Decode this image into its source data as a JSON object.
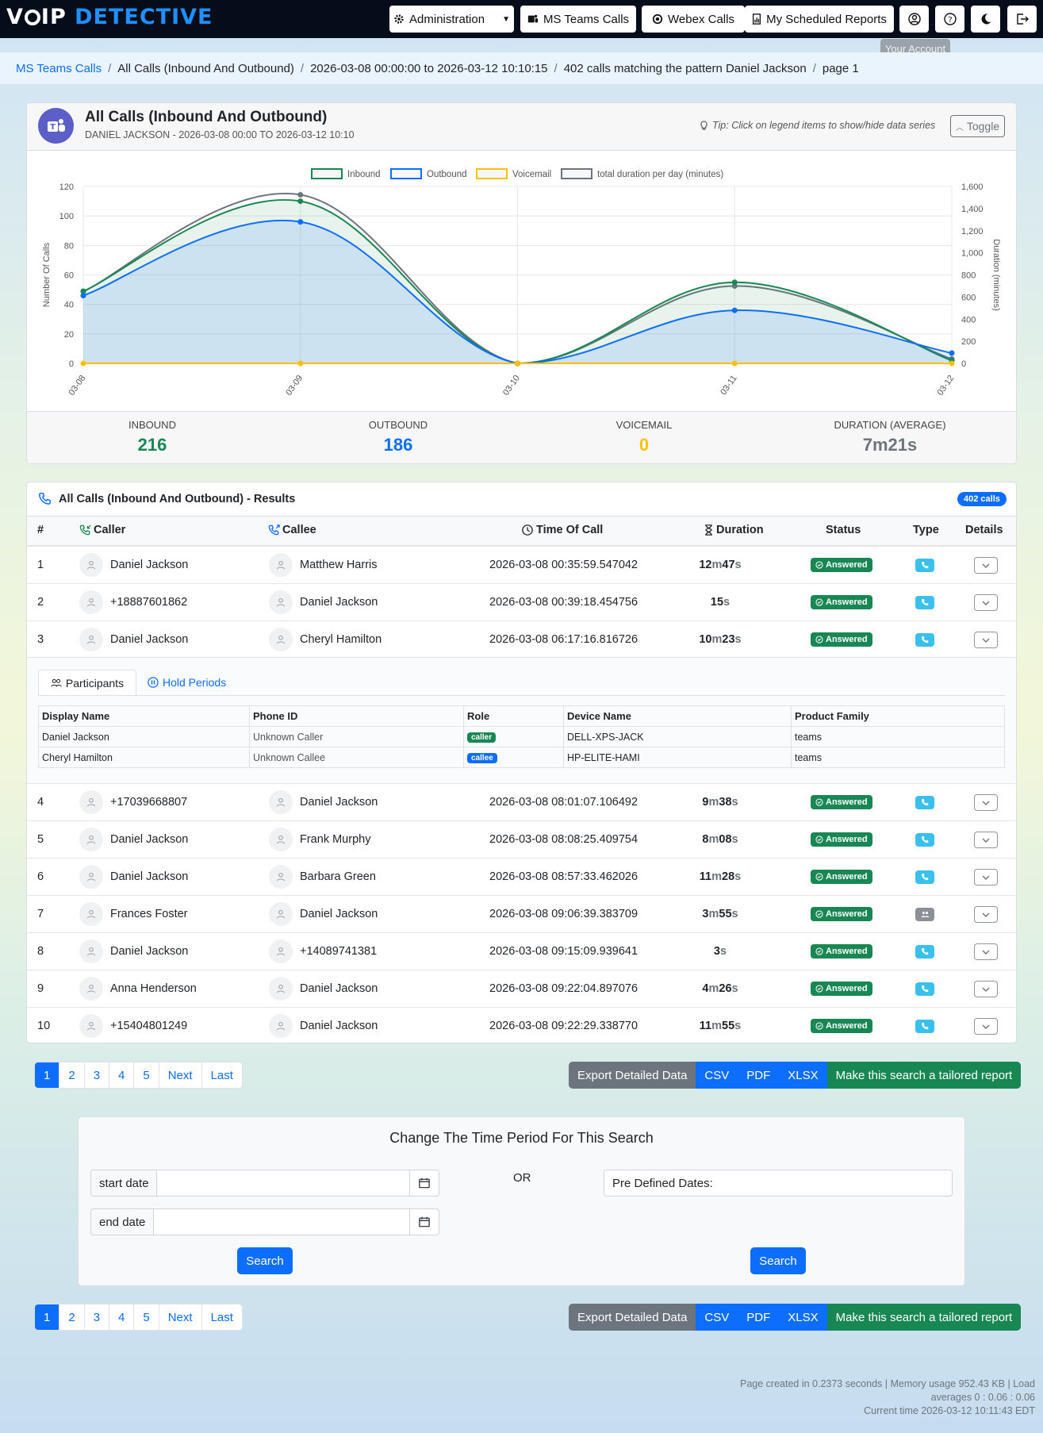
{
  "nav": {
    "logo_a": "V",
    "logo_b": "IP ",
    "logo_c": "DETECTIVE",
    "administration": "Administration",
    "ms_teams": "MS Teams Calls",
    "webex": "Webex Calls",
    "scheduled": "My Scheduled Reports",
    "tooltip": "Your Account"
  },
  "breadcrumb": [
    "MS Teams Calls",
    "All Calls (Inbound And Outbound)",
    "2026-03-08 00:00:00 to 2026-03-12 10:10:15",
    "402 calls matching the pattern Daniel Jackson",
    "page 1"
  ],
  "chart_card": {
    "title": "All Calls (Inbound And Outbound)",
    "subtitle": "DANIEL JACKSON - 2026-03-08 00:00 TO 2026-03-12 10:10",
    "tip": "Tip: Click on legend items to show/hide data series",
    "toggle": "Toggle"
  },
  "chart_data": {
    "type": "line",
    "x": [
      "03-08",
      "03-09",
      "03-10",
      "03-11",
      "03-12"
    ],
    "ylabel": "Number Of Calls",
    "y2label": "Duration (minutes)",
    "ylim": [
      0,
      120
    ],
    "y2lim": [
      0,
      1600
    ],
    "yticks": [
      "120",
      "100",
      "80",
      "60",
      "40",
      "20",
      "0"
    ],
    "y2ticks": [
      "1,600",
      "1,400",
      "1,200",
      "1,000",
      "800",
      "600",
      "400",
      "200",
      "0"
    ],
    "series": [
      {
        "name": "Inbound",
        "values": [
          49,
          110,
          0,
          55,
          2
        ],
        "color": "#198754"
      },
      {
        "name": "Outbound",
        "values": [
          46,
          96,
          0,
          36,
          7
        ],
        "color": "#0d6efd"
      },
      {
        "name": "Voicemail",
        "values": [
          0,
          0,
          0,
          0,
          0
        ],
        "color": "#ffc107"
      },
      {
        "name": "total duration per day (minutes)",
        "values": [
          650,
          1525,
          0,
          700,
          40
        ],
        "color": "#6c757d",
        "axis": "right"
      }
    ]
  },
  "stats": [
    {
      "label": "INBOUND",
      "value": "216",
      "color": "#198754"
    },
    {
      "label": "OUTBOUND",
      "value": "186",
      "color": "#0d6efd"
    },
    {
      "label": "VOICEMAIL",
      "value": "0",
      "color": "#ffc107"
    },
    {
      "label": "DURATION (AVERAGE)",
      "value": "7m21s",
      "color": "#6c757d"
    }
  ],
  "results": {
    "title": "All Calls (Inbound And Outbound) - Results",
    "count": "402 calls",
    "headers": [
      "#",
      "Caller",
      "Callee",
      "Time Of Call",
      "Duration",
      "Status",
      "Type",
      "Details"
    ]
  },
  "rows": [
    {
      "n": "1",
      "caller": "Daniel Jackson",
      "callee": "Matthew Harris",
      "time": "2026-03-08 00:35:59.547042",
      "dur": [
        [
          "12",
          "m"
        ],
        [
          "47",
          "s"
        ]
      ],
      "status": "Answered",
      "type": "phone"
    },
    {
      "n": "2",
      "caller": "+18887601862",
      "callee": "Daniel Jackson",
      "time": "2026-03-08 00:39:18.454756",
      "dur": [
        [
          "15",
          "s"
        ]
      ],
      "status": "Answered",
      "type": "phone"
    },
    {
      "n": "3",
      "caller": "Daniel Jackson",
      "callee": "Cheryl Hamilton",
      "time": "2026-03-08 06:17:16.816726",
      "dur": [
        [
          "10",
          "m"
        ],
        [
          "23",
          "s"
        ]
      ],
      "status": "Answered",
      "type": "phone"
    },
    {
      "n": "4",
      "caller": "+17039668807",
      "callee": "Daniel Jackson",
      "time": "2026-03-08 08:01:07.106492",
      "dur": [
        [
          "9",
          "m"
        ],
        [
          "38",
          "s"
        ]
      ],
      "status": "Answered",
      "type": "phone"
    },
    {
      "n": "5",
      "caller": "Daniel Jackson",
      "callee": "Frank Murphy",
      "time": "2026-03-08 08:08:25.409754",
      "dur": [
        [
          "8",
          "m"
        ],
        [
          "08",
          "s"
        ]
      ],
      "status": "Answered",
      "type": "phone"
    },
    {
      "n": "6",
      "caller": "Daniel Jackson",
      "callee": "Barbara Green",
      "time": "2026-03-08 08:57:33.462026",
      "dur": [
        [
          "11",
          "m"
        ],
        [
          "28",
          "s"
        ]
      ],
      "status": "Answered",
      "type": "phone"
    },
    {
      "n": "7",
      "caller": "Frances Foster",
      "callee": "Daniel Jackson",
      "time": "2026-03-08 09:06:39.383709",
      "dur": [
        [
          "3",
          "m"
        ],
        [
          "55",
          "s"
        ]
      ],
      "status": "Answered",
      "type": "group"
    },
    {
      "n": "8",
      "caller": "Daniel Jackson",
      "callee": "+14089741381",
      "time": "2026-03-08 09:15:09.939641",
      "dur": [
        [
          "3",
          "s"
        ]
      ],
      "status": "Answered",
      "type": "phone"
    },
    {
      "n": "9",
      "caller": "Anna Henderson",
      "callee": "Daniel Jackson",
      "time": "2026-03-08 09:22:04.897076",
      "dur": [
        [
          "4",
          "m"
        ],
        [
          "26",
          "s"
        ]
      ],
      "status": "Answered",
      "type": "phone"
    },
    {
      "n": "10",
      "caller": "+15404801249",
      "callee": "Daniel Jackson",
      "time": "2026-03-08 09:22:29.338770",
      "dur": [
        [
          "11",
          "m"
        ],
        [
          "55",
          "s"
        ]
      ],
      "status": "Answered",
      "type": "phone"
    }
  ],
  "details": {
    "tab_participants": "Participants",
    "tab_hold": "Hold Periods",
    "headers": [
      "Display Name",
      "Phone ID",
      "Role",
      "Device Name",
      "Product Family"
    ],
    "rows": [
      [
        "Daniel Jackson",
        "Unknown Caller",
        "caller",
        "DELL-XPS-JACK",
        "teams"
      ],
      [
        "Cheryl Hamilton",
        "Unknown Callee",
        "callee",
        "HP-ELITE-HAMI",
        "teams"
      ]
    ]
  },
  "pager": [
    "1",
    "2",
    "3",
    "4",
    "5",
    "Next",
    "Last"
  ],
  "export": {
    "label": "Export Detailed Data",
    "csv": "CSV",
    "pdf": "PDF",
    "xlsx": "XLSX",
    "tailored": "Make this search a tailored report"
  },
  "period": {
    "title": "Change The Time Period For This Search",
    "start": "start date",
    "end": "end date",
    "or": "OR",
    "predefined": "Pre Defined Dates:",
    "search": "Search"
  },
  "footer": {
    "line1": "Page created in 0.2373 seconds | Memory usage 952.43 KB | Load",
    "line2": "averages 0 : 0.06 : 0.06",
    "line3": "Current time 2026-03-12 10:11:43 EDT"
  }
}
